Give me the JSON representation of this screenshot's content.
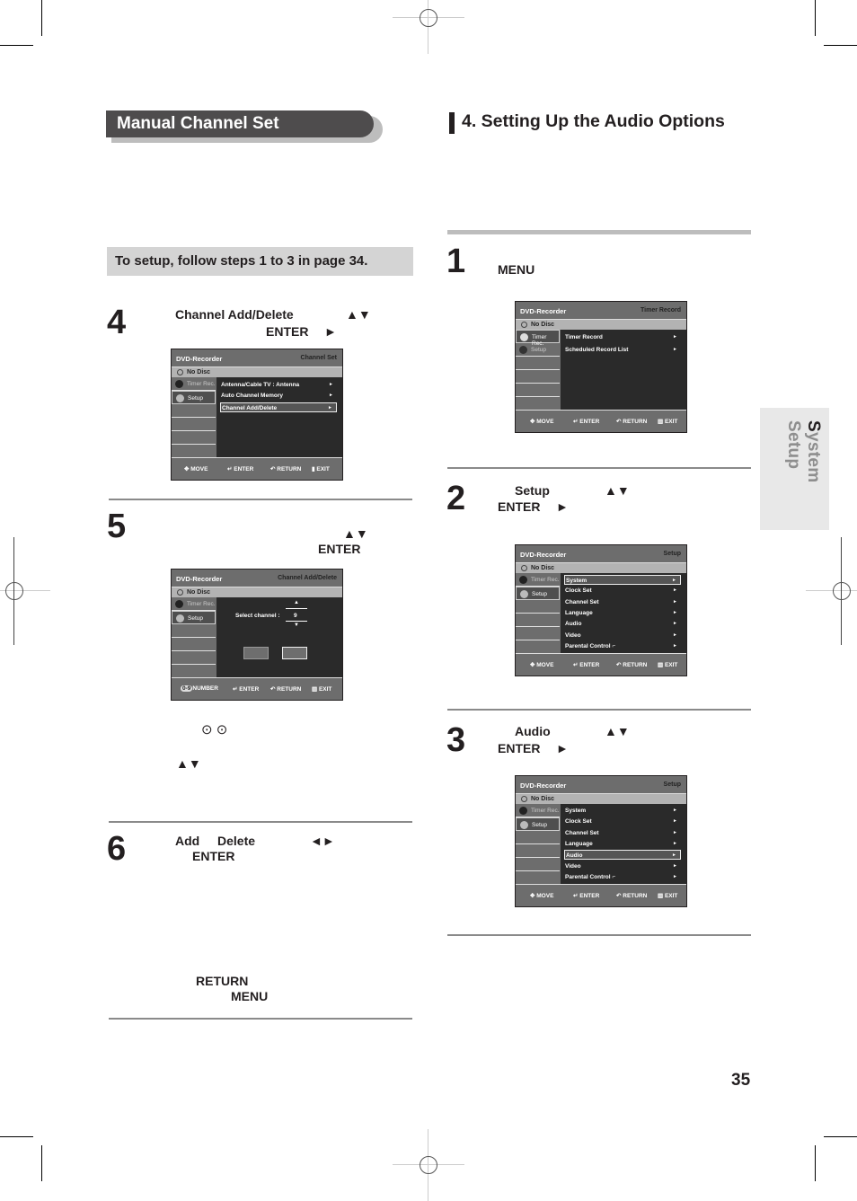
{
  "left_section": {
    "title": "Manual Channel Set",
    "note": "To setup, follow steps 1 to 3 in page 34.",
    "steps": [
      {
        "num": "4",
        "line1_a": "Channel Add/Delete",
        "line1_b": "▲▼",
        "line2_a": "ENTER",
        "line2_b": "►"
      },
      {
        "num": "5",
        "line1_b": "▲▼",
        "line2_a": "ENTER",
        "icons_up_down": "⊙ ⊙",
        "arrows": "▲▼"
      },
      {
        "num": "6",
        "line1_a": "Add",
        "line1_b": "Delete",
        "line1_c": "◄►",
        "line2_a": "ENTER",
        "return_label": "RETURN",
        "menu_label": "MENU"
      }
    ]
  },
  "right_section": {
    "title": "4.  Setting Up the Audio Options",
    "steps": [
      {
        "num": "1",
        "line1_a": "MENU"
      },
      {
        "num": "2",
        "line1_a": "Setup",
        "line1_b": "▲▼",
        "line2_a": "ENTER",
        "line2_b": "►"
      },
      {
        "num": "3",
        "line1_a": "Audio",
        "line1_b": "▲▼",
        "line2_a": "ENTER",
        "line2_b": "►"
      }
    ]
  },
  "side_tab": {
    "first_letter": "S",
    "rest": "ystem Setup"
  },
  "page_number": "35",
  "osd_common": {
    "device": "DVD-Recorder",
    "disc": "No Disc",
    "nav_timer": "Timer Rec.",
    "nav_setup": "Setup",
    "foot_move": "MOVE",
    "foot_enter": "ENTER",
    "foot_return": "RETURN",
    "foot_exit": "EXIT",
    "foot_number": "NUMBER",
    "number_badge": "0-9"
  },
  "osd_screens": {
    "channel_set": {
      "title": "Channel Set",
      "items": [
        "Antenna/Cable TV : Antenna",
        "Auto Channel Memory",
        "Channel Add/Delete"
      ],
      "selected_index": 2
    },
    "channel_add_delete": {
      "title": "Channel Add/Delete",
      "label": "Select channel :",
      "value": "9"
    },
    "timer_record": {
      "title": "Timer Record",
      "items": [
        "Timer Record",
        "Scheduled Record List"
      ]
    },
    "setup_system": {
      "title": "Setup",
      "items": [
        "System",
        "Clock Set",
        "Channel Set",
        "Language",
        "Audio",
        "Video",
        "Parental Control ⌐"
      ],
      "selected_index": 0
    },
    "setup_audio": {
      "title": "Setup",
      "items": [
        "System",
        "Clock Set",
        "Channel Set",
        "Language",
        "Audio",
        "Video",
        "Parental Control ⌐"
      ],
      "selected_index": 4
    }
  }
}
